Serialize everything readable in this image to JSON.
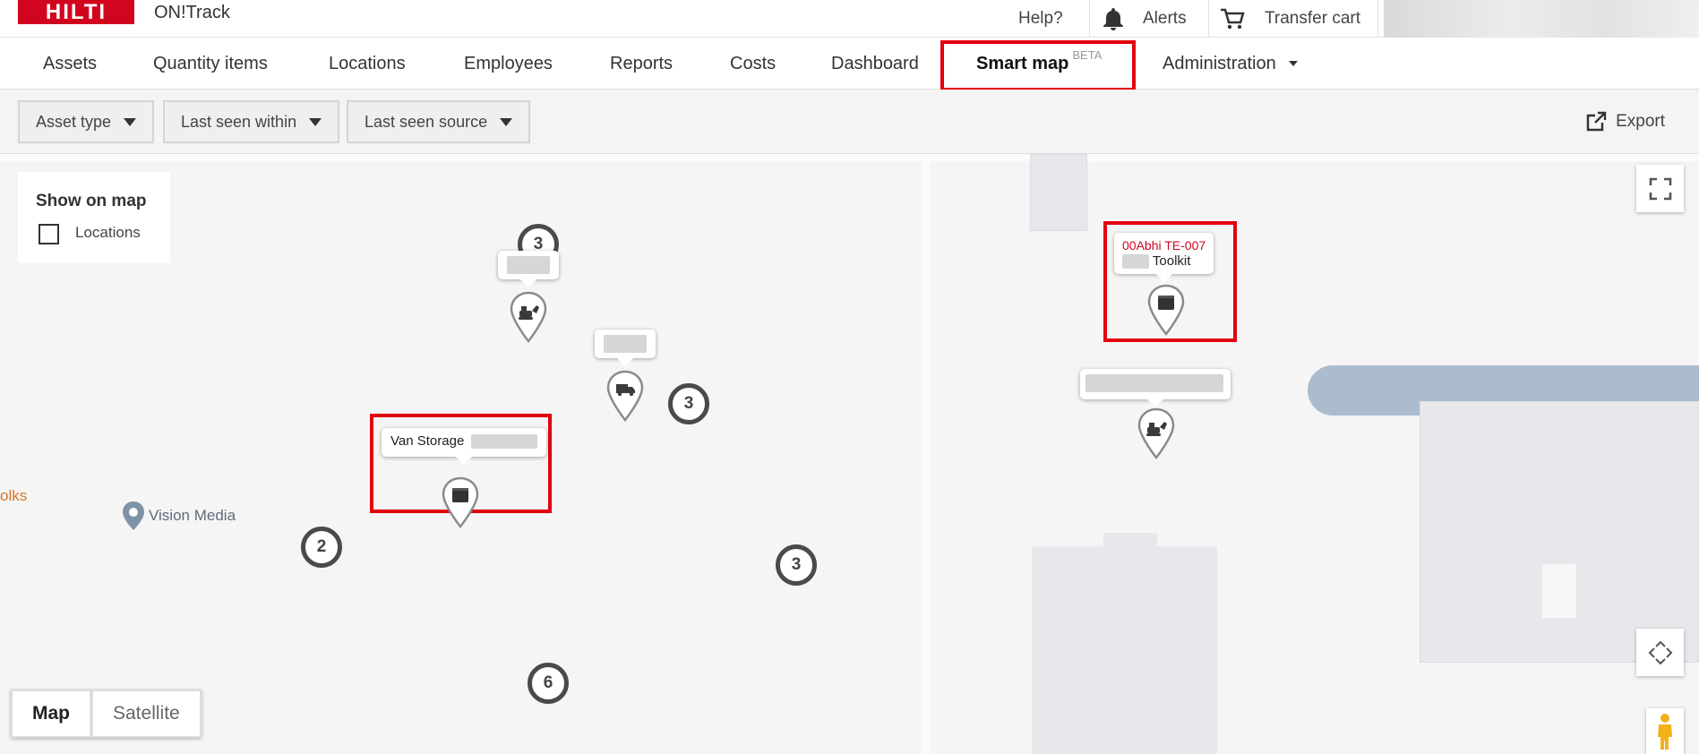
{
  "header": {
    "logo_text": "HILTI",
    "app_name": "ON!Track",
    "help_label": "Help?",
    "alerts_label": "Alerts",
    "transfer_cart_label": "Transfer cart"
  },
  "nav": {
    "items": [
      {
        "label": "Assets"
      },
      {
        "label": "Quantity items"
      },
      {
        "label": "Locations"
      },
      {
        "label": "Employees"
      },
      {
        "label": "Reports"
      },
      {
        "label": "Costs"
      },
      {
        "label": "Dashboard"
      },
      {
        "label": "Smart map",
        "badge": "BETA",
        "active": true
      },
      {
        "label": "Administration"
      }
    ]
  },
  "filters": {
    "asset_type": "Asset type",
    "last_seen_within": "Last seen within",
    "last_seen_source": "Last seen source",
    "export_label": "Export"
  },
  "map": {
    "show_on_map_title": "Show on map",
    "locations_checkbox_label": "Locations",
    "locations_checked": false,
    "clusters": [
      "3",
      "3",
      "2",
      "3",
      "6"
    ],
    "markers": {
      "van_storage": "Van Storage",
      "toolkit_name": "00Abhi TE-007",
      "toolkit_type": "Toolkit"
    },
    "poi_vision_media": "Vision Media",
    "poi_side_fragment": "olks",
    "map_type": {
      "map": "Map",
      "satellite": "Satellite",
      "selected": "Map"
    }
  },
  "colors": {
    "brand": "#d2051e",
    "highlight": "#e3000f",
    "asset_name_red": "#d2051e",
    "cluster_border": "#4a4a4a"
  },
  "icons": [
    "bell-icon",
    "cart-icon",
    "export-icon",
    "fullscreen-icon",
    "pan-icon",
    "pegman-icon",
    "excavator-icon",
    "truck-icon",
    "box-icon"
  ]
}
